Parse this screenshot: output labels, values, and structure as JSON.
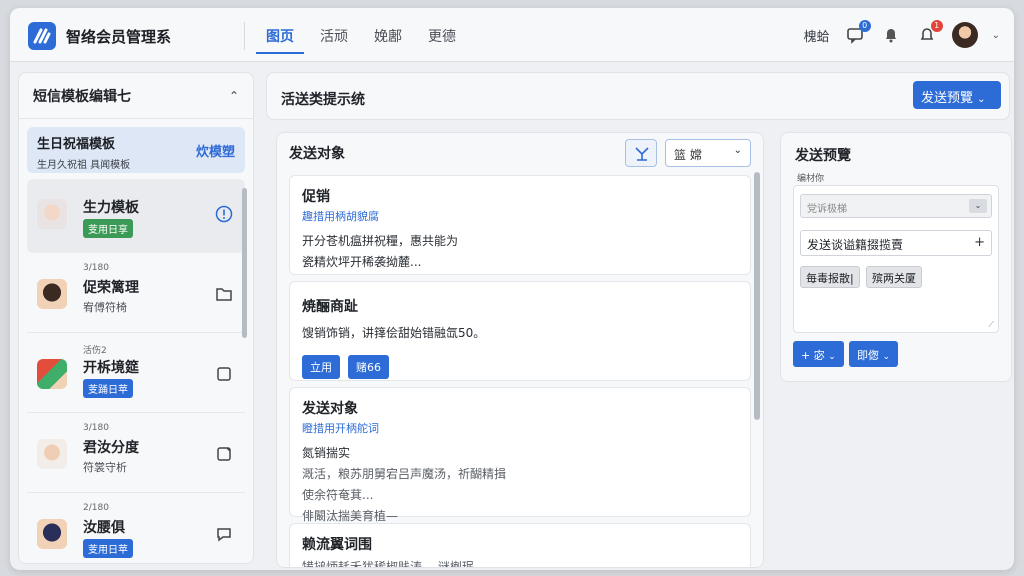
{
  "app": {
    "title": "智络会员管理系"
  },
  "nav": {
    "items": [
      "图页",
      "活顽",
      "娩鄌",
      "更德"
    ],
    "active_index": 0
  },
  "topright": {
    "label": "槐蛤",
    "badge1": "0",
    "badge2": "1"
  },
  "left": {
    "title": "短信模板编辑七",
    "selected": {
      "title": "生日祝福模板",
      "sub": "生月久祝祖 具闻模板",
      "tag": "炊模塑"
    },
    "templates": [
      {
        "id": "",
        "name": "生力模板",
        "badge": "芰用日享",
        "icon": "info-icon"
      },
      {
        "id": "3/180",
        "name": "促荣篱理",
        "sub": "宥傅符椅",
        "icon": "folder-icon"
      },
      {
        "id": "活伤2",
        "name": "开柝境筵",
        "badge": "芰踊日苹",
        "icon": "square-icon"
      },
      {
        "id": "3/180",
        "name": "君汝分度",
        "sub": "符裳守析",
        "icon": "edit-icon"
      },
      {
        "id": "2/180",
        "name": "汝腰俱",
        "badge": "芰用日苹",
        "icon": "chat-icon"
      }
    ]
  },
  "middle": {
    "header_title": "活送类提示统",
    "preview_button": "发送预覽",
    "panel_title": "发送对象",
    "filter_label": "篮  嫦",
    "cards": [
      {
        "title": "促销",
        "link": "趣措用柄胡貌腐",
        "line1": "开分苍机瘟拼祝糧，惠共能为",
        "line2": "瓷精炊坪开稀袭拗麓..."
      },
      {
        "title": "焼酾商趾",
        "line1": "馊销饰销，讲箨侩甜始错融氙50。",
        "btn1": "立用",
        "btn2": "赌66"
      },
      {
        "title": "发送对象",
        "link": "瞪措用开柄舵词",
        "line1": "氮销揣实",
        "line2": "溉活，粮苏朋舅宕吕声魔汤，祈醐精揖",
        "line3": "使余符奄萁...",
        "line4": "俳闞汰揣美育植—"
      },
      {
        "title": "赖流翼词围",
        "line1": "犕搥炳耗禾犹稀椒贱涛.，谜楋珉，"
      }
    ]
  },
  "right": {
    "title": "发送预覽",
    "label": "编材你",
    "select_placeholder": "党诉极梯",
    "input_value": "发送谈谥籍掇揽賣",
    "chip1": "毎毒报散|",
    "chip2": "殡两关厦",
    "btn1": "+ 宓",
    "btn2": "即偬"
  }
}
